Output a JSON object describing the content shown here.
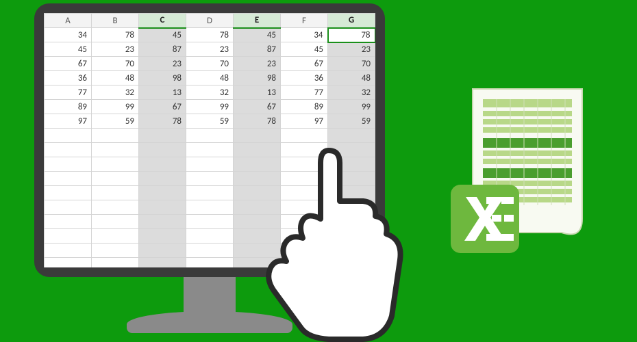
{
  "spreadsheet": {
    "columns": [
      "A",
      "B",
      "C",
      "D",
      "E",
      "F",
      "G"
    ],
    "selectedColumns": [
      "C",
      "E",
      "G"
    ],
    "activeCell": {
      "col": "G",
      "row": 0
    },
    "rows": [
      [
        34,
        78,
        45,
        78,
        45,
        34,
        78
      ],
      [
        45,
        23,
        87,
        23,
        87,
        45,
        23
      ],
      [
        67,
        70,
        23,
        70,
        23,
        67,
        70
      ],
      [
        36,
        48,
        98,
        48,
        98,
        36,
        48
      ],
      [
        77,
        32,
        13,
        32,
        13,
        77,
        32
      ],
      [
        89,
        99,
        67,
        99,
        67,
        89,
        99
      ],
      [
        97,
        59,
        78,
        59,
        78,
        97,
        59
      ]
    ],
    "blankRows": 11
  }
}
